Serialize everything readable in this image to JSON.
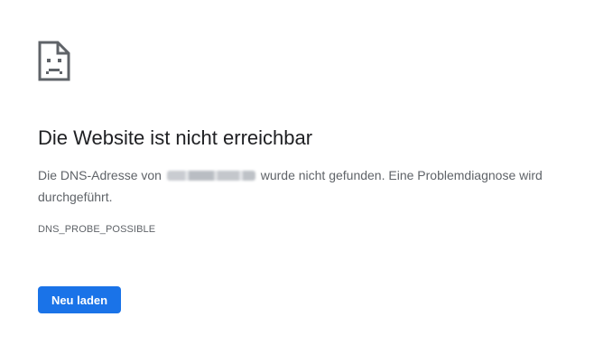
{
  "error_page": {
    "icon": "sad-document-icon",
    "title": "Die Website ist nicht erreichbar",
    "description_prefix": "Die DNS-Adresse von",
    "description_suffix": "wurde nicht gefunden. Eine Problemdiagnose wird durchgeführt.",
    "error_code": "DNS_PROBE_POSSIBLE",
    "reload_button_label": "Neu laden"
  },
  "colors": {
    "accent": "#1a73e8",
    "title_text": "#202124",
    "body_text": "#5f6368",
    "background": "#ffffff"
  }
}
